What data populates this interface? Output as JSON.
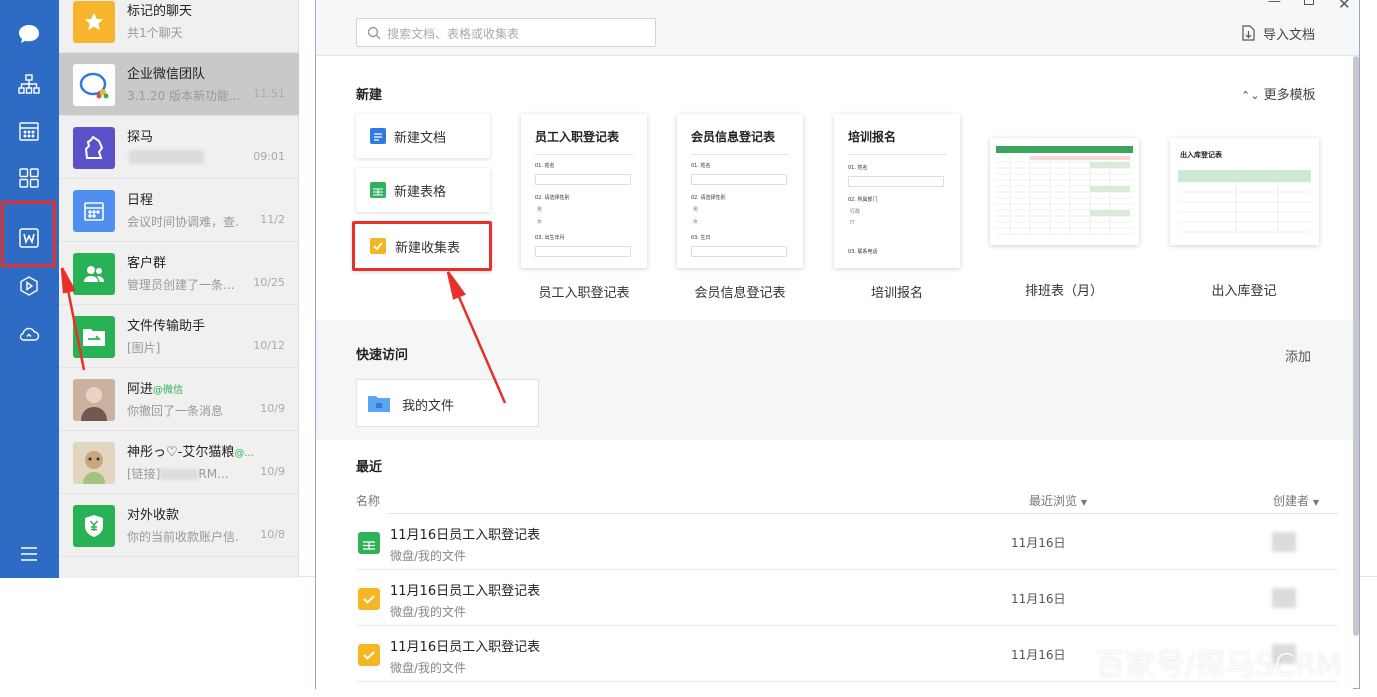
{
  "chats": [
    {
      "name": "标记的聊天",
      "sub": "共1个聊天",
      "time": ""
    },
    {
      "name": "企业微信团队",
      "sub": "3.1.20 版本新功能...",
      "time": "11:51"
    },
    {
      "name": "探马",
      "sub": "",
      "time": "09:01"
    },
    {
      "name": "日程",
      "sub": "会议时间协调难，查...",
      "time": "11/2"
    },
    {
      "name": "客户群",
      "sub": "管理员创建了一条...",
      "time": "10/25"
    },
    {
      "name": "文件传输助手",
      "sub": "[图片]",
      "time": "10/12"
    },
    {
      "name": "阿进",
      "name_tag": "@微信",
      "sub": "你撤回了一条消息",
      "time": "10/9"
    },
    {
      "name": "神彤っ♡-艾尔猫粮",
      "name_tag": "@...",
      "sub": "[链接]",
      "sub_tail": "RM...",
      "time": "10/9"
    },
    {
      "name": "对外收款",
      "sub": "你的当前收款账户信...",
      "time": "10/8"
    }
  ],
  "topbar": {
    "search_placeholder": "搜索文档、表格或收集表",
    "import_label": "导入文档"
  },
  "new_section": {
    "title": "新建",
    "more_templates": "更多模板",
    "buttons": [
      "新建文档",
      "新建表格",
      "新建收集表"
    ]
  },
  "templates": [
    {
      "title": "员工入职登记表",
      "label": "员工入职登记表",
      "q1": "01. 姓名",
      "q2": "02. 请选择性别",
      "o1": "男",
      "o2": "女",
      "q3": "03. 出生年月"
    },
    {
      "title": "会员信息登记表",
      "label": "会员信息登记表",
      "q1": "01. 姓名",
      "q2": "02. 请选择性别",
      "o1": "男",
      "o2": "女",
      "q3": "03. 生日"
    },
    {
      "title": "培训报名",
      "label": "培训报名",
      "q1": "01. 姓名",
      "q2": "02. 所属部门",
      "o1": "行政",
      "o2": "IT",
      "q3": "03. 联系电话"
    },
    {
      "title": "",
      "label": "排班表（月）"
    },
    {
      "title": "出入库登记表",
      "label": "出入库登记"
    }
  ],
  "quick": {
    "title": "快速访问",
    "add": "添加",
    "myfiles": "我的文件"
  },
  "recent": {
    "title": "最近",
    "col_name": "名称",
    "col_browse": "最近浏览",
    "col_creator": "创建者",
    "rows": [
      {
        "name": "11月16日员工入职登记表",
        "path": "微盘/我的文件",
        "date": "11月16日",
        "type": "sheet"
      },
      {
        "name": "11月16日员工入职登记表",
        "path": "微盘/我的文件",
        "date": "11月16日",
        "type": "form"
      },
      {
        "name": "11月16日员工入职登记表",
        "path": "微盘/我的文件",
        "date": "11月16日",
        "type": "form"
      }
    ]
  },
  "watermark": "百家号/探马SCRM",
  "colors": {
    "rail": "#2e6bc4",
    "highlight": "#e8302a",
    "form_icon": "#f5b623",
    "sheet_icon": "#2fb35a",
    "doc_icon": "#2f7be0"
  }
}
